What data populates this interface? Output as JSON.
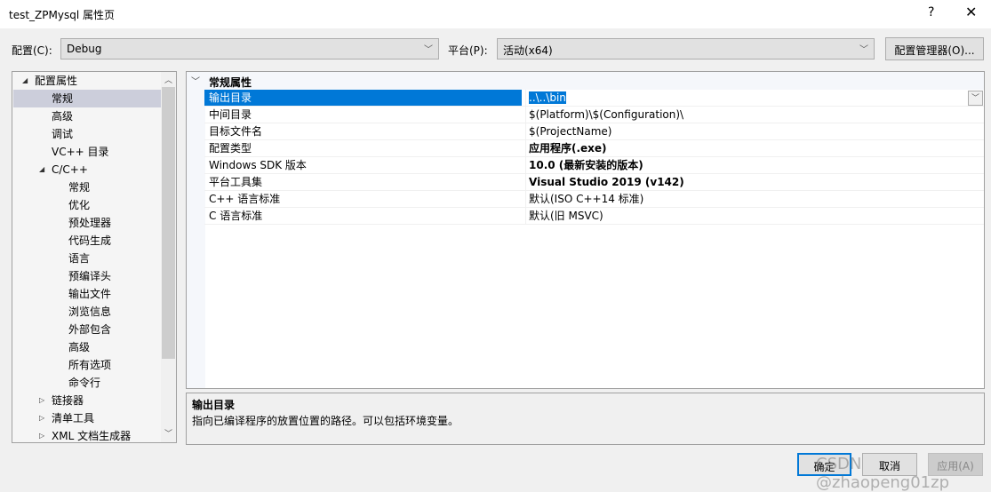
{
  "window": {
    "title": "test_ZPMysql 属性页",
    "help": "?",
    "close": "✕"
  },
  "config": {
    "label": "配置(C):",
    "value": "Debug",
    "platform_label": "平台(P):",
    "platform_value": "活动(x64)",
    "manager_button": "配置管理器(O)..."
  },
  "tree": [
    {
      "label": "配置属性",
      "level": 0,
      "arrow": "◢"
    },
    {
      "label": "常规",
      "level": 1,
      "selected": true
    },
    {
      "label": "高级",
      "level": 1
    },
    {
      "label": "调试",
      "level": 1
    },
    {
      "label": "VC++ 目录",
      "level": 1
    },
    {
      "label": "C/C++",
      "level": 1,
      "arrow": "◢"
    },
    {
      "label": "常规",
      "level": 2
    },
    {
      "label": "优化",
      "level": 2
    },
    {
      "label": "预处理器",
      "level": 2
    },
    {
      "label": "代码生成",
      "level": 2
    },
    {
      "label": "语言",
      "level": 2
    },
    {
      "label": "预编译头",
      "level": 2
    },
    {
      "label": "输出文件",
      "level": 2
    },
    {
      "label": "浏览信息",
      "level": 2
    },
    {
      "label": "外部包含",
      "level": 2
    },
    {
      "label": "高级",
      "level": 2
    },
    {
      "label": "所有选项",
      "level": 2
    },
    {
      "label": "命令行",
      "level": 2
    },
    {
      "label": "链接器",
      "level": 1,
      "arrow": "▷"
    },
    {
      "label": "清单工具",
      "level": 1,
      "arrow": "▷"
    },
    {
      "label": "XML 文档生成器",
      "level": 1,
      "arrow": "▷"
    }
  ],
  "grid": {
    "category": "常规属性",
    "rows": [
      {
        "name": "输出目录",
        "value": "..\\..\\bin",
        "selected": true
      },
      {
        "name": "中间目录",
        "value": "$(Platform)\\$(Configuration)\\"
      },
      {
        "name": "目标文件名",
        "value": "$(ProjectName)"
      },
      {
        "name": "配置类型",
        "value": "应用程序(.exe)",
        "bold": true
      },
      {
        "name": "Windows SDK 版本",
        "value": "10.0 (最新安装的版本)",
        "bold": true
      },
      {
        "name": "平台工具集",
        "value": "Visual Studio 2019 (v142)",
        "bold": true
      },
      {
        "name": "C++ 语言标准",
        "value": "默认(ISO C++14 标准)"
      },
      {
        "name": "C 语言标准",
        "value": "默认(旧 MSVC)"
      }
    ]
  },
  "description": {
    "title": "输出目录",
    "text": "指向已编译程序的放置位置的路径。可以包括环境变量。"
  },
  "buttons": {
    "ok": "确定",
    "cancel": "取消",
    "apply": "应用(A)"
  },
  "watermark": "CSDN @zhaopeng01zp"
}
